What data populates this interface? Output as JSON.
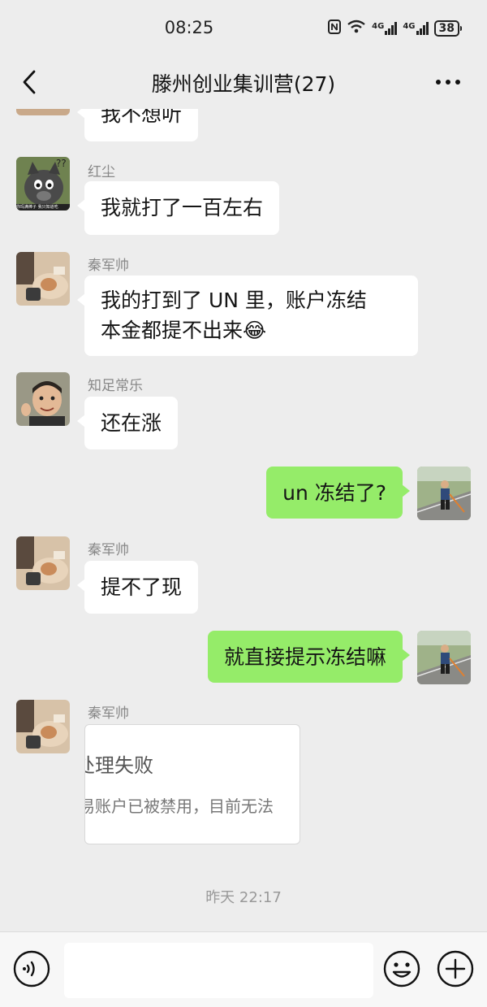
{
  "status_bar": {
    "time": "08:25",
    "battery": "38",
    "network_a": "4G",
    "network_b": "4G"
  },
  "header": {
    "title": "滕州创业集训营(27)"
  },
  "messages": [
    {
      "text": "我不想听"
    },
    {
      "sender": "红尘",
      "text": "我就打了一百左右"
    },
    {
      "sender": "秦军帅",
      "line1": "我的打到了 UN 里，账户冻结",
      "line2": "本金都提不出来😂"
    },
    {
      "sender": "知足常乐",
      "text": "还在涨"
    },
    {
      "text": "un 冻结了?"
    },
    {
      "sender": "秦军帅",
      "text": "提不了现"
    },
    {
      "text": "就直接提示冻结嘛"
    },
    {
      "sender": "秦军帅",
      "image_title": "处理失败",
      "image_body": "易账户已被禁用，目前无法"
    }
  ],
  "timestamp": "昨天 22:17",
  "avatar_caption": "你玛满棒子 我只知道吃"
}
